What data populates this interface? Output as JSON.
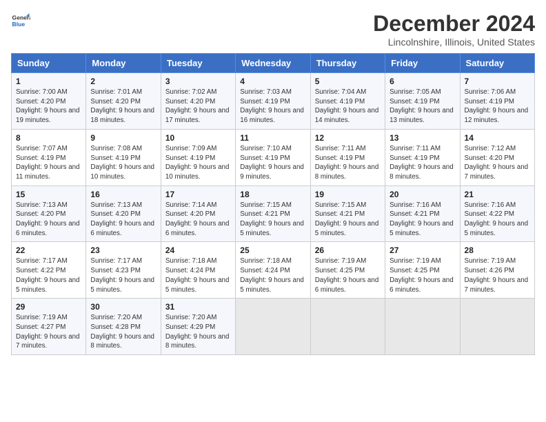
{
  "header": {
    "logo_general": "General",
    "logo_blue": "Blue",
    "month_title": "December 2024",
    "location": "Lincolnshire, Illinois, United States"
  },
  "days_of_week": [
    "Sunday",
    "Monday",
    "Tuesday",
    "Wednesday",
    "Thursday",
    "Friday",
    "Saturday"
  ],
  "weeks": [
    [
      {
        "day": "1",
        "sunrise": "7:00 AM",
        "sunset": "4:20 PM",
        "daylight": "9 hours and 19 minutes."
      },
      {
        "day": "2",
        "sunrise": "7:01 AM",
        "sunset": "4:20 PM",
        "daylight": "9 hours and 18 minutes."
      },
      {
        "day": "3",
        "sunrise": "7:02 AM",
        "sunset": "4:20 PM",
        "daylight": "9 hours and 17 minutes."
      },
      {
        "day": "4",
        "sunrise": "7:03 AM",
        "sunset": "4:19 PM",
        "daylight": "9 hours and 16 minutes."
      },
      {
        "day": "5",
        "sunrise": "7:04 AM",
        "sunset": "4:19 PM",
        "daylight": "9 hours and 14 minutes."
      },
      {
        "day": "6",
        "sunrise": "7:05 AM",
        "sunset": "4:19 PM",
        "daylight": "9 hours and 13 minutes."
      },
      {
        "day": "7",
        "sunrise": "7:06 AM",
        "sunset": "4:19 PM",
        "daylight": "9 hours and 12 minutes."
      }
    ],
    [
      {
        "day": "8",
        "sunrise": "7:07 AM",
        "sunset": "4:19 PM",
        "daylight": "9 hours and 11 minutes."
      },
      {
        "day": "9",
        "sunrise": "7:08 AM",
        "sunset": "4:19 PM",
        "daylight": "9 hours and 10 minutes."
      },
      {
        "day": "10",
        "sunrise": "7:09 AM",
        "sunset": "4:19 PM",
        "daylight": "9 hours and 10 minutes."
      },
      {
        "day": "11",
        "sunrise": "7:10 AM",
        "sunset": "4:19 PM",
        "daylight": "9 hours and 9 minutes."
      },
      {
        "day": "12",
        "sunrise": "7:11 AM",
        "sunset": "4:19 PM",
        "daylight": "9 hours and 8 minutes."
      },
      {
        "day": "13",
        "sunrise": "7:11 AM",
        "sunset": "4:19 PM",
        "daylight": "9 hours and 8 minutes."
      },
      {
        "day": "14",
        "sunrise": "7:12 AM",
        "sunset": "4:20 PM",
        "daylight": "9 hours and 7 minutes."
      }
    ],
    [
      {
        "day": "15",
        "sunrise": "7:13 AM",
        "sunset": "4:20 PM",
        "daylight": "9 hours and 6 minutes."
      },
      {
        "day": "16",
        "sunrise": "7:13 AM",
        "sunset": "4:20 PM",
        "daylight": "9 hours and 6 minutes."
      },
      {
        "day": "17",
        "sunrise": "7:14 AM",
        "sunset": "4:20 PM",
        "daylight": "9 hours and 6 minutes."
      },
      {
        "day": "18",
        "sunrise": "7:15 AM",
        "sunset": "4:21 PM",
        "daylight": "9 hours and 5 minutes."
      },
      {
        "day": "19",
        "sunrise": "7:15 AM",
        "sunset": "4:21 PM",
        "daylight": "9 hours and 5 minutes."
      },
      {
        "day": "20",
        "sunrise": "7:16 AM",
        "sunset": "4:21 PM",
        "daylight": "9 hours and 5 minutes."
      },
      {
        "day": "21",
        "sunrise": "7:16 AM",
        "sunset": "4:22 PM",
        "daylight": "9 hours and 5 minutes."
      }
    ],
    [
      {
        "day": "22",
        "sunrise": "7:17 AM",
        "sunset": "4:22 PM",
        "daylight": "9 hours and 5 minutes."
      },
      {
        "day": "23",
        "sunrise": "7:17 AM",
        "sunset": "4:23 PM",
        "daylight": "9 hours and 5 minutes."
      },
      {
        "day": "24",
        "sunrise": "7:18 AM",
        "sunset": "4:24 PM",
        "daylight": "9 hours and 5 minutes."
      },
      {
        "day": "25",
        "sunrise": "7:18 AM",
        "sunset": "4:24 PM",
        "daylight": "9 hours and 5 minutes."
      },
      {
        "day": "26",
        "sunrise": "7:19 AM",
        "sunset": "4:25 PM",
        "daylight": "9 hours and 6 minutes."
      },
      {
        "day": "27",
        "sunrise": "7:19 AM",
        "sunset": "4:25 PM",
        "daylight": "9 hours and 6 minutes."
      },
      {
        "day": "28",
        "sunrise": "7:19 AM",
        "sunset": "4:26 PM",
        "daylight": "9 hours and 7 minutes."
      }
    ],
    [
      {
        "day": "29",
        "sunrise": "7:19 AM",
        "sunset": "4:27 PM",
        "daylight": "9 hours and 7 minutes."
      },
      {
        "day": "30",
        "sunrise": "7:20 AM",
        "sunset": "4:28 PM",
        "daylight": "9 hours and 8 minutes."
      },
      {
        "day": "31",
        "sunrise": "7:20 AM",
        "sunset": "4:29 PM",
        "daylight": "9 hours and 8 minutes."
      },
      null,
      null,
      null,
      null
    ]
  ]
}
